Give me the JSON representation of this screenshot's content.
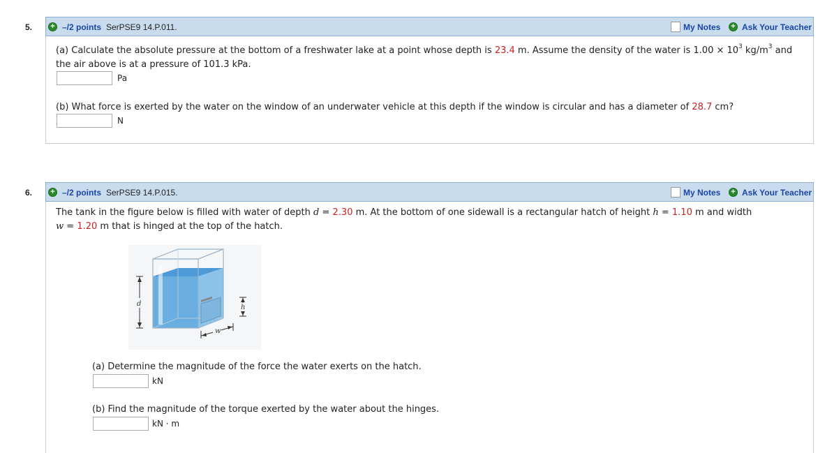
{
  "q5": {
    "number": "5.",
    "points": "–/2 points",
    "code": "SerPSE9 14.P.011.",
    "my_notes": "My Notes",
    "ask_teacher": "Ask Your Teacher",
    "part_a_text1": "(a) Calculate the absolute pressure at the bottom of a freshwater lake at a point whose depth is ",
    "part_a_val": "23.4",
    "part_a_text2": " m. Assume the density of the water is 1.00 × 10",
    "part_a_exp": "3",
    "part_a_text3": " kg/m",
    "part_a_exp2": "3",
    "part_a_text4": " and",
    "part_a_line2": "the air above is at a pressure of 101.3 kPa.",
    "part_a_unit": "Pa",
    "part_b_text1": "(b) What force is exerted by the water on the window of an underwater vehicle at this depth if the window is circular and has a diameter of ",
    "part_b_val": "28.7",
    "part_b_text2": " cm?",
    "part_b_unit": "N"
  },
  "q6": {
    "number": "6.",
    "points": "–/2 points",
    "code": "SerPSE9 14.P.015.",
    "my_notes": "My Notes",
    "ask_teacher": "Ask Your Teacher",
    "intro_1": "The tank in the figure below is filled with water of depth ",
    "d_sym": "d",
    "eq1": " = ",
    "d_val": "2.30",
    "intro_2": " m.  At the bottom of one sidewall is a rectangular hatch of height ",
    "h_sym": "h",
    "eq2": " = ",
    "h_val": "1.10",
    "intro_3": " m  and width",
    "w_sym": "w",
    "eq3": " = ",
    "w_val": "1.20",
    "intro_4": " m  that is hinged at the top of the hatch.",
    "fig_label_d": "d",
    "fig_label_h": "h",
    "fig_label_w": "w",
    "part_a_text": "(a) Determine the magnitude of the force the water exerts on the hatch.",
    "part_a_unit": "kN",
    "part_b_text": "(b) Find the magnitude of the torque exerted by the water about the hinges.",
    "part_b_unit": "kN · m"
  }
}
